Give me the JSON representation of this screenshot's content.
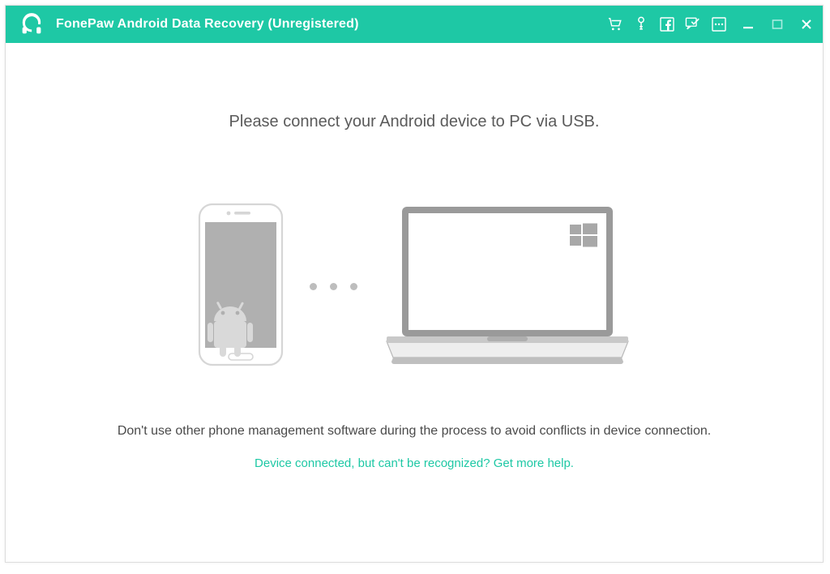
{
  "header": {
    "title": "FonePaw Android Data Recovery (Unregistered)"
  },
  "main": {
    "headline": "Please connect your Android device to PC via USB.",
    "warning": "Don't use other phone management software during the process to avoid conflicts in device connection.",
    "help_link": "Device connected, but can't be recognized? Get more help."
  },
  "colors": {
    "accent": "#1ec8a5"
  }
}
